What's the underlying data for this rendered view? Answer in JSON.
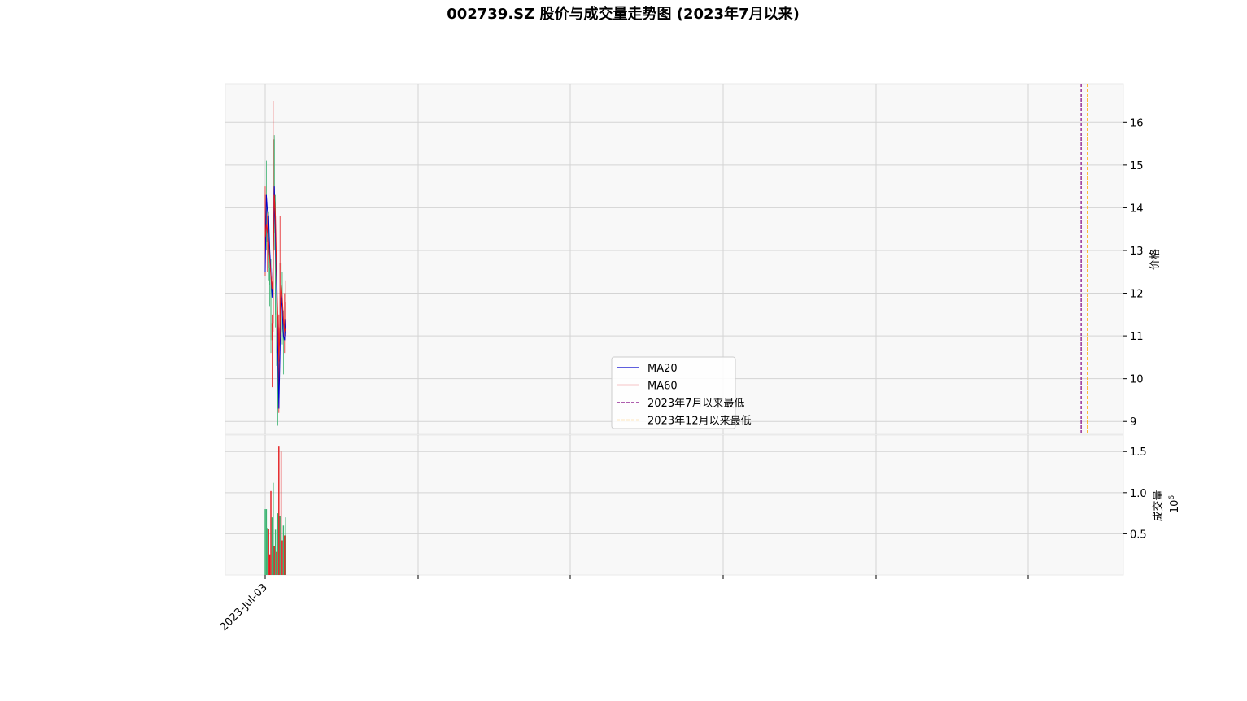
{
  "title": "002739.SZ 股价与成交量走势图 (2023年7月以来)",
  "chart_data": [
    {
      "panel": "price",
      "type": "candlestick",
      "ylabel": "价格",
      "ylim": [
        8.7,
        16.9
      ],
      "y_ticks": [
        9,
        10,
        11,
        12,
        13,
        14,
        15,
        16
      ],
      "x_ticks": [
        "2023-Jul-03",
        "",
        "",
        "",
        "",
        ""
      ],
      "grid": true,
      "legend_position": "center",
      "up_color": "#e41a1c",
      "down_color": "#3cb371",
      "candles": [
        {
          "o": 12.5,
          "h": 14.5,
          "l": 12.4,
          "c": 14.3
        },
        {
          "o": 14.3,
          "h": 15.1,
          "l": 13.0,
          "c": 13.2
        },
        {
          "o": 13.2,
          "h": 13.9,
          "l": 12.5,
          "c": 13.8
        },
        {
          "o": 13.8,
          "h": 13.9,
          "l": 12.3,
          "c": 12.6
        },
        {
          "o": 12.6,
          "h": 12.9,
          "l": 11.7,
          "c": 12.2
        },
        {
          "o": 12.2,
          "h": 12.8,
          "l": 10.6,
          "c": 10.9
        },
        {
          "o": 10.9,
          "h": 11.5,
          "l": 9.8,
          "c": 11.3
        },
        {
          "o": 11.3,
          "h": 16.5,
          "l": 11.1,
          "c": 15.6
        },
        {
          "o": 15.6,
          "h": 15.7,
          "l": 13.0,
          "c": 13.4
        },
        {
          "o": 13.4,
          "h": 14.3,
          "l": 11.2,
          "c": 11.5
        },
        {
          "o": 11.5,
          "h": 12.1,
          "l": 10.3,
          "c": 10.6
        },
        {
          "o": 10.6,
          "h": 11.0,
          "l": 8.9,
          "c": 9.3
        },
        {
          "o": 9.3,
          "h": 11.5,
          "l": 9.2,
          "c": 11.2
        },
        {
          "o": 11.2,
          "h": 13.8,
          "l": 11.0,
          "c": 12.7
        },
        {
          "o": 12.7,
          "h": 14.0,
          "l": 11.6,
          "c": 11.9
        },
        {
          "o": 11.9,
          "h": 12.5,
          "l": 10.8,
          "c": 11.1
        },
        {
          "o": 11.1,
          "h": 11.6,
          "l": 10.1,
          "c": 10.9
        },
        {
          "o": 10.9,
          "h": 12.0,
          "l": 10.6,
          "c": 11.4
        },
        {
          "o": 11.4,
          "h": 12.3,
          "l": 11.0,
          "c": 11.8
        }
      ],
      "series": [
        {
          "name": "MA20",
          "color": "#0000cc",
          "values": [
            12.5,
            14.3,
            13.9,
            13.8,
            13.0,
            12.5,
            11.9,
            12.8,
            14.5,
            13.3,
            12.1,
            10.8,
            9.3,
            10.6,
            12.0,
            11.6,
            11.0,
            10.9,
            11.4
          ]
        },
        {
          "name": "MA60",
          "color": "#e41a1c",
          "values": [
            13.3,
            13.6,
            13.4,
            13.2,
            12.8,
            12.4,
            12.1,
            12.6,
            14.3,
            13.8,
            12.5,
            11.5,
            10.4,
            11.2,
            12.2,
            11.9,
            11.4,
            11.1,
            11.2
          ]
        },
        {
          "name": "2023年7月以来最低",
          "color": "#800080",
          "dashed": true,
          "vline_position": 0.953
        },
        {
          "name": "2023年12月以来最低",
          "color": "#ffa500",
          "dashed": true,
          "vline_position": 0.96
        }
      ]
    },
    {
      "panel": "volume",
      "type": "bar",
      "ylabel": "成交量",
      "y_multiplier": "10",
      "y_multiplier_exp": "6",
      "ylim": [
        0,
        1.7
      ],
      "y_ticks": [
        0.5,
        1.0,
        1.5
      ],
      "y_tick_labels": [
        "0.5",
        "1.0",
        "1.5"
      ],
      "grid": true,
      "up_color": "#e41a1c",
      "down_color": "#3cb371",
      "values": [
        0.8,
        0.8,
        0.57,
        0.56,
        0.25,
        1.02,
        0.7,
        1.12,
        0.35,
        0.55,
        0.28,
        0.75,
        1.56,
        0.72,
        1.5,
        0.42,
        0.6,
        0.48,
        0.7
      ],
      "directions": [
        "down",
        "down",
        "down",
        "up",
        "up",
        "up",
        "down",
        "down",
        "up",
        "down",
        "up",
        "down",
        "up",
        "down",
        "up",
        "up",
        "down",
        "up",
        "down"
      ]
    }
  ]
}
